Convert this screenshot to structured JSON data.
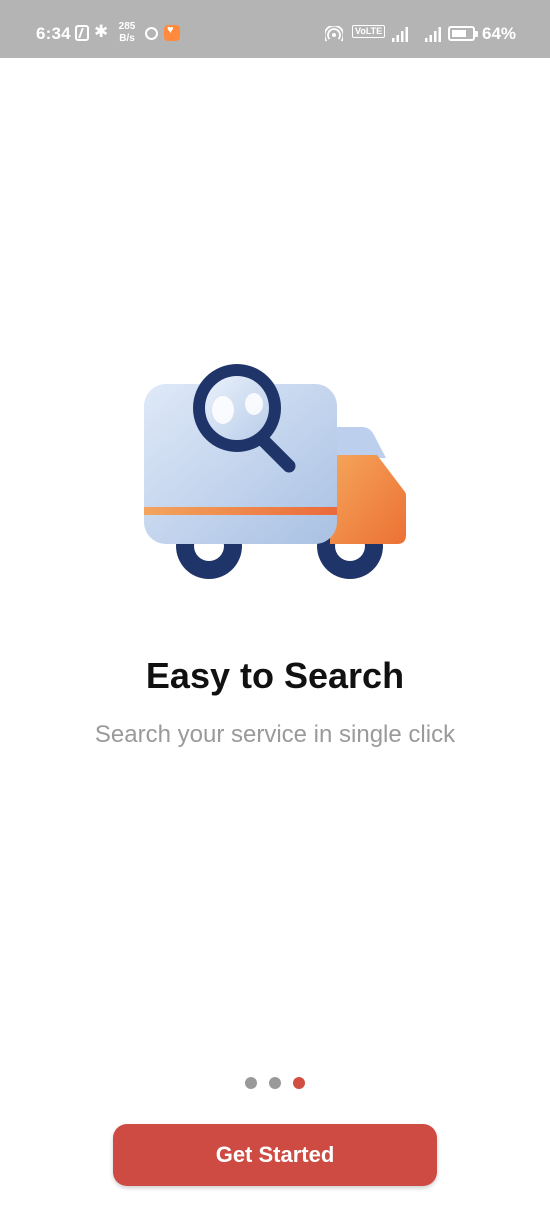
{
  "status_bar": {
    "time": "6:34",
    "net_speed_value": "285",
    "net_speed_unit": "B/s",
    "volte_label": "VoLTE",
    "battery_percent": "64%",
    "bluetooth_glyph": "✱",
    "icons": [
      "nfc-icon",
      "bluetooth-icon",
      "app-notification-icon",
      "app-notification-icon",
      "hotspot-icon",
      "volte-icon",
      "signal-icon",
      "signal-icon",
      "battery-icon"
    ]
  },
  "onboarding": {
    "title": "Easy to Search",
    "subtitle": "Search your service in single click",
    "illustration": "delivery-truck-search-illustration",
    "pager": {
      "total": 3,
      "active_index": 2,
      "active_color": "#d24e42",
      "inactive_color": "#999999"
    }
  },
  "cta": {
    "label": "Get Started",
    "color": "#cd4b42"
  }
}
